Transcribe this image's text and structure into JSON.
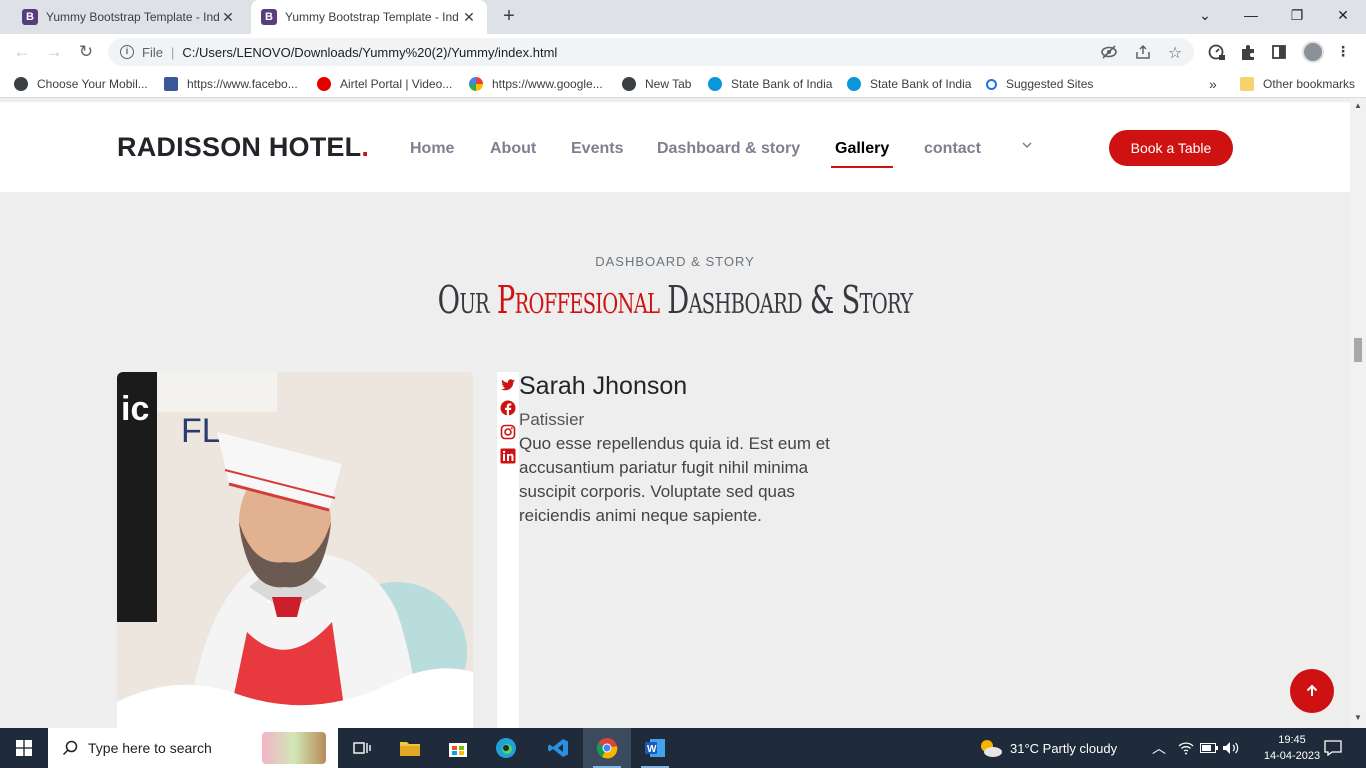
{
  "browser": {
    "tabs": [
      {
        "label": "Yummy Bootstrap Template - Ind",
        "favicon": "B",
        "active": false
      },
      {
        "label": "Yummy Bootstrap Template - Ind",
        "favicon": "B",
        "active": true
      }
    ],
    "address": {
      "scheme_label": "File",
      "url": "C:/Users/LENOVO/Downloads/Yummy%20(2)/Yummy/index.html"
    },
    "bookmarks": [
      {
        "label": "Choose Your Mobil...",
        "icon": "globe-icon"
      },
      {
        "label": "https://www.facebo...",
        "icon": "facebook-icon"
      },
      {
        "label": "Airtel Portal | Video...",
        "icon": "airtel-icon"
      },
      {
        "label": "https://www.google...",
        "icon": "google-icon"
      },
      {
        "label": "New Tab",
        "icon": "globe-icon"
      },
      {
        "label": "State Bank of India",
        "icon": "sbi-icon"
      },
      {
        "label": "State Bank of India",
        "icon": "sbi-icon"
      },
      {
        "label": "Suggested Sites",
        "icon": "search-icon"
      }
    ],
    "bookmarks_overflow": "»",
    "other_bookmarks": "Other bookmarks"
  },
  "site": {
    "logo": "RADISSON HOTEL",
    "logo_dot": ".",
    "nav": [
      "Home",
      "About",
      "Events",
      "Dashboard & story",
      "Gallery",
      "contact"
    ],
    "active_nav": "Gallery",
    "book_button": "Book a Table"
  },
  "section": {
    "subtitle": "DASHBOARD & STORY",
    "title_prefix": "Our ",
    "title_accent": "Proffesional",
    "title_suffix": " Dashboard & Story"
  },
  "member": {
    "name": "Sarah Jhonson",
    "role": "Patissier",
    "bio": "Quo esse repellendus quia id. Est eum et accusantium pariatur fugit nihil minima suscipit corporis. Voluptate sed quas reiciendis animi neque sapiente.",
    "social": [
      "twitter-icon",
      "facebook-icon",
      "instagram-icon",
      "linkedin-icon"
    ]
  },
  "taskbar": {
    "search_placeholder": "Type here to search",
    "weather": "31°C  Partly cloudy",
    "time": "19:45",
    "date": "14-04-2023"
  },
  "colors": {
    "accent": "#ce1212",
    "taskbar": "#1f2b3a"
  }
}
